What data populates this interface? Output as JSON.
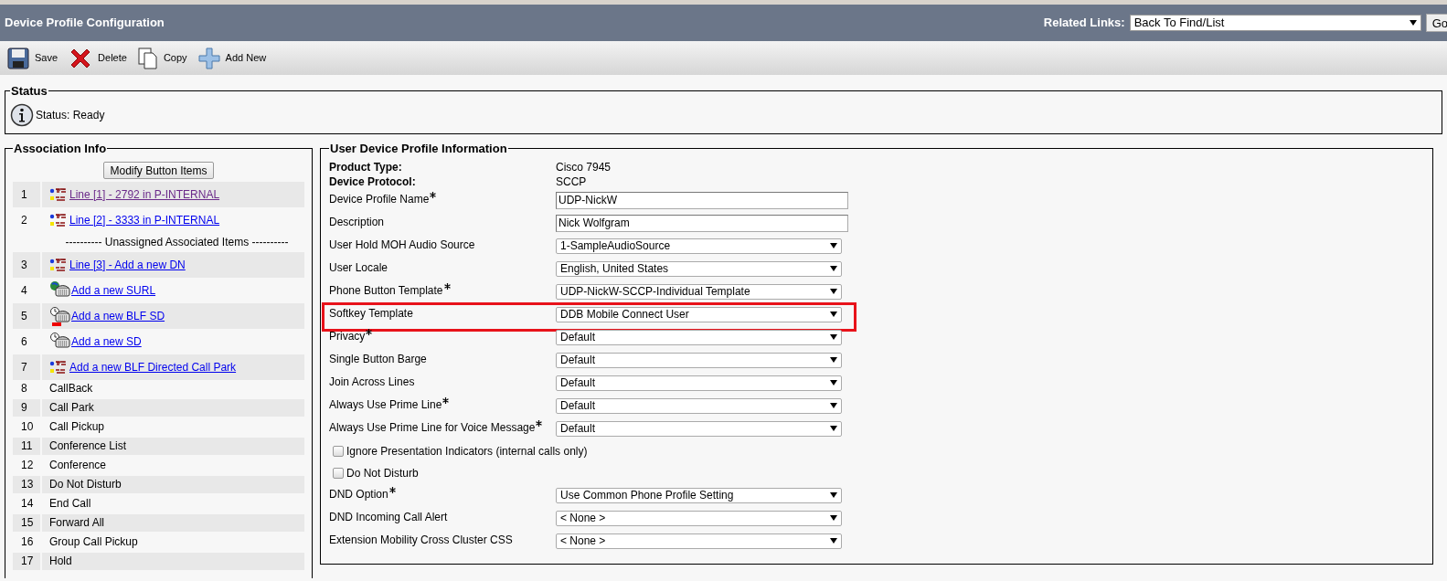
{
  "header": {
    "title": "Device Profile Configuration",
    "related_links_label": "Related Links:",
    "related_links_value": "Back To Find/List",
    "go_button": "Go"
  },
  "toolbar": [
    {
      "kind": "save",
      "label": "Save"
    },
    {
      "kind": "delete",
      "label": "Delete"
    },
    {
      "kind": "copy",
      "label": "Copy"
    },
    {
      "kind": "add",
      "label": "Add New"
    }
  ],
  "status": {
    "legend": "Status",
    "message": "Status: Ready"
  },
  "association_info": {
    "legend": "Association Info",
    "button": "Modify Button Items",
    "rows": [
      {
        "kind": "line",
        "number": "1",
        "label": "Line [1] - 2792 in P-INTERNAL",
        "visited": true
      },
      {
        "kind": "line",
        "number": "2",
        "label": "Line [2] - 3333 in P-INTERNAL",
        "visited": false
      },
      {
        "kind": "separator",
        "label": "---------- Unassigned Associated Items ----------"
      },
      {
        "kind": "line",
        "number": "3",
        "label": "Line [3] - Add a new DN",
        "visited": false
      },
      {
        "kind": "surl",
        "number": "4",
        "label": "Add a new SURL",
        "visited": false
      },
      {
        "kind": "blf",
        "number": "5",
        "label": "Add a new BLF SD",
        "visited": false
      },
      {
        "kind": "sd",
        "number": "6",
        "label": "Add a new SD",
        "visited": false
      },
      {
        "kind": "line",
        "number": "7",
        "label": "Add a new BLF Directed Call Park",
        "visited": false
      },
      {
        "kind": "plain",
        "number": "8",
        "label": "CallBack"
      },
      {
        "kind": "plain",
        "number": "9",
        "label": "Call Park"
      },
      {
        "kind": "plain",
        "number": "10",
        "label": "Call Pickup"
      },
      {
        "kind": "plain",
        "number": "11",
        "label": "Conference List"
      },
      {
        "kind": "plain",
        "number": "12",
        "label": "Conference"
      },
      {
        "kind": "plain",
        "number": "13",
        "label": "Do Not Disturb"
      },
      {
        "kind": "plain",
        "number": "14",
        "label": "End Call"
      },
      {
        "kind": "plain",
        "number": "15",
        "label": "Forward All"
      },
      {
        "kind": "plain",
        "number": "16",
        "label": "Group Call Pickup"
      },
      {
        "kind": "plain",
        "number": "17",
        "label": "Hold"
      }
    ]
  },
  "profile_info": {
    "legend": "User Device Profile Information",
    "fields": [
      {
        "kind": "static",
        "label": "Product Type:",
        "value": "Cisco 7945"
      },
      {
        "kind": "static",
        "label": "Device Protocol:",
        "value": "SCCP"
      },
      {
        "kind": "text",
        "label": "Device Profile Name",
        "required": true,
        "value": "UDP-NickW",
        "highlighted": false
      },
      {
        "kind": "text",
        "label": "Description",
        "required": false,
        "value": "Nick Wolfgram",
        "highlighted": false
      },
      {
        "kind": "select",
        "label": "User Hold MOH Audio Source",
        "required": false,
        "value": "1-SampleAudioSource",
        "highlighted": false
      },
      {
        "kind": "select",
        "label": "User Locale",
        "required": false,
        "value": "English, United States",
        "highlighted": false
      },
      {
        "kind": "select",
        "label": "Phone Button Template",
        "required": true,
        "value": "UDP-NickW-SCCP-Individual Template",
        "highlighted": false
      },
      {
        "kind": "select",
        "label": "Softkey Template",
        "required": false,
        "value": "DDB Mobile Connect User",
        "highlighted": true
      },
      {
        "kind": "select",
        "label": "Privacy",
        "required": true,
        "value": "Default",
        "highlighted": false
      },
      {
        "kind": "select",
        "label": "Single Button Barge",
        "required": false,
        "value": "Default",
        "highlighted": false
      },
      {
        "kind": "select",
        "label": "Join Across Lines",
        "required": false,
        "value": "Default",
        "highlighted": false
      },
      {
        "kind": "select",
        "label": "Always Use Prime Line",
        "required": true,
        "value": "Default",
        "highlighted": false
      },
      {
        "kind": "select",
        "label": "Always Use Prime Line for Voice Message",
        "required": true,
        "value": "Default",
        "highlighted": false
      },
      {
        "kind": "checkbox",
        "label": "Ignore Presentation Indicators (internal calls only)",
        "checked": false
      },
      {
        "kind": "checkbox",
        "label": "Do Not Disturb",
        "checked": false
      },
      {
        "kind": "select",
        "label": "DND Option",
        "required": true,
        "value": "Use Common Phone Profile Setting",
        "highlighted": false
      },
      {
        "kind": "select",
        "label": "DND Incoming Call Alert",
        "required": false,
        "value": "< None >",
        "highlighted": false
      },
      {
        "kind": "select",
        "label": "Extension Mobility Cross Cluster CSS",
        "required": false,
        "value": "< None >",
        "highlighted": false
      }
    ]
  }
}
